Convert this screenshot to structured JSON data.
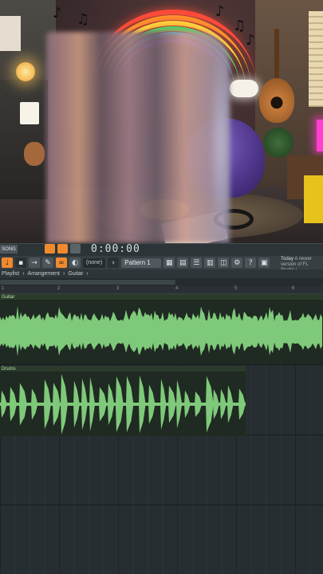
{
  "transport": {
    "song_mode": "SONG",
    "time": "0:00:00"
  },
  "toolbar": {
    "snap_value": "(none)",
    "pattern": "Pattern 1",
    "news_prefix": "Today",
    "news_text": "A newer version of FL Studio i..."
  },
  "playlist": {
    "breadcrumb": [
      "Playlist",
      "Arrangement",
      "Guitar"
    ],
    "separator": "›",
    "bar_numbers": [
      "1",
      "2",
      "3",
      "4",
      "5",
      "6"
    ],
    "tracks": [
      {
        "name": "Guitar",
        "color": "#7fc97a"
      },
      {
        "name": "Drums",
        "color": "#7fc97a"
      }
    ]
  },
  "colors": {
    "accent": "#f08a2f",
    "waveform": "#7fc97a",
    "grid_bg": "#262e31"
  },
  "icons": [
    "music-note-icon",
    "rainbow-neon",
    "play-icon",
    "record-icon",
    "metronome-icon",
    "mixer-icon",
    "piano-roll-icon"
  ]
}
